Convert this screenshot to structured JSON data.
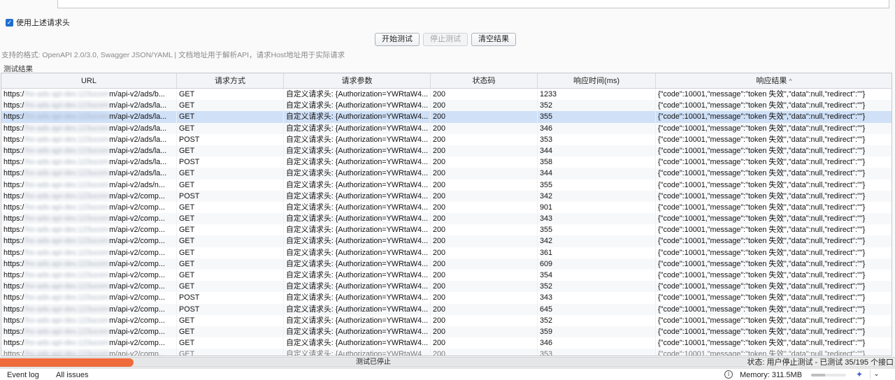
{
  "header": {
    "checkbox_checked": true,
    "checkbox_mark": "✓",
    "checkbox_label": "使用上述请求头"
  },
  "buttons": {
    "start": "开始测试",
    "stop": "停止测试",
    "clear": "清空结果"
  },
  "hint": "支持的格式: OpenAPI 2.0/3.0, Swagger JSON/YAML | 文档地址用于解析API，请求Host地址用于实际请求",
  "section_label": "测试结果",
  "table": {
    "columns": [
      "URL",
      "请求方式",
      "请求参数",
      "状态码",
      "响应时间(ms)",
      "响应结果"
    ],
    "sort_indicator": "^",
    "url_prefix": "https:/",
    "url_hidden_host": "/ho-ads-api-dev.123ucom",
    "param_text": "自定义请求头: {Authorization=YWRtaW4...",
    "response_text": "{\"code\":10001,\"message\":\"token 失效\",\"data\":null,\"redirect\":\"\"}",
    "status_code": "200",
    "rows": [
      {
        "path": "m/api-v2/ads/b...",
        "method": "GET",
        "time": "1233"
      },
      {
        "path": "m/api-v2/ads/la...",
        "method": "GET",
        "time": "352"
      },
      {
        "path": "m/api-v2/ads/la...",
        "method": "GET",
        "time": "355",
        "selected": true
      },
      {
        "path": "m/api-v2/ads/la...",
        "method": "GET",
        "time": "346"
      },
      {
        "path": "m/api-v2/ads/la...",
        "method": "POST",
        "time": "353"
      },
      {
        "path": "m/api-v2/ads/la...",
        "method": "GET",
        "time": "344"
      },
      {
        "path": "m/api-v2/ads/la...",
        "method": "POST",
        "time": "358"
      },
      {
        "path": "m/api-v2/ads/la...",
        "method": "GET",
        "time": "344"
      },
      {
        "path": "m/api-v2/ads/n...",
        "method": "GET",
        "time": "355"
      },
      {
        "path": "m/api-v2/comp...",
        "method": "POST",
        "time": "342"
      },
      {
        "path": "m/api-v2/comp...",
        "method": "GET",
        "time": "901"
      },
      {
        "path": "m/api-v2/comp...",
        "method": "GET",
        "time": "343"
      },
      {
        "path": "m/api-v2/comp...",
        "method": "GET",
        "time": "355"
      },
      {
        "path": "m/api-v2/comp...",
        "method": "GET",
        "time": "342"
      },
      {
        "path": "m/api-v2/comp...",
        "method": "GET",
        "time": "361"
      },
      {
        "path": "m/api-v2/comp...",
        "method": "GET",
        "time": "609"
      },
      {
        "path": "m/api-v2/comp...",
        "method": "GET",
        "time": "354"
      },
      {
        "path": "m/api-v2/comp...",
        "method": "GET",
        "time": "352"
      },
      {
        "path": "m/api-v2/comp...",
        "method": "POST",
        "time": "343"
      },
      {
        "path": "m/api-v2/comp...",
        "method": "POST",
        "time": "645"
      },
      {
        "path": "m/api-v2/comp...",
        "method": "GET",
        "time": "352"
      },
      {
        "path": "m/api-v2/comp...",
        "method": "GET",
        "time": "359"
      },
      {
        "path": "m/api-v2/comp...",
        "method": "GET",
        "time": "346"
      },
      {
        "path": "m/api-v2/comp...",
        "method": "GET",
        "time": "353",
        "partial": true
      }
    ]
  },
  "progress": {
    "label": "测试已停止",
    "fraction": 0.179,
    "color": "#ef6b3c"
  },
  "status": "状态: 用户停止测试 - 已测试 35/195 个接口",
  "devtools": {
    "tabs": [
      "Event log",
      "All issues"
    ],
    "info_icon": "i",
    "memory": "Memory: 311.5MB",
    "memory_fraction": 0.4,
    "sparkle_icon": "✦",
    "chevron_icon": "⌄"
  }
}
